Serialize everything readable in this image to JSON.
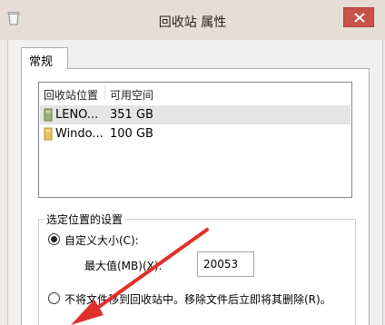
{
  "window": {
    "title": "回收站 属性"
  },
  "tabs": [
    {
      "label": "常规"
    }
  ],
  "list": {
    "headers": [
      "回收站位置",
      "可用空间"
    ],
    "rows": [
      {
        "name": "LENO...",
        "space": "351 GB",
        "selected": true,
        "icon": "drive-icon"
      },
      {
        "name": "Windo...",
        "space": "100 GB",
        "selected": false,
        "icon": "folder-drive-icon"
      }
    ]
  },
  "settings": {
    "group_title": "选定位置的设置",
    "custom_size_label": "自定义大小(C):",
    "max_size_label": "最大值(MB)(X):",
    "max_size_value": "20053",
    "no_move_label": "不将文件移到回收站中。移除文件后立即将其删除(R)。"
  },
  "colors": {
    "close_button": "#c9524a",
    "selected_row": "#e5e5e5",
    "annotation_arrow": "#e0302a"
  }
}
